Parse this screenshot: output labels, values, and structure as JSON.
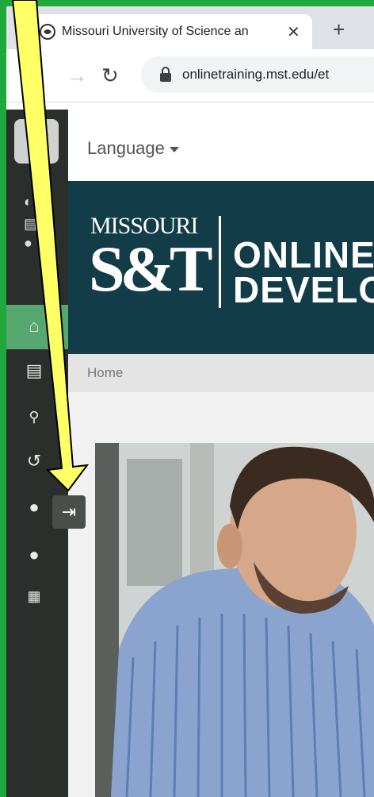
{
  "browser": {
    "tab_title": "Missouri University of Science an",
    "new_tab_label": "+",
    "url": "onlinetraining.mst.edu/et"
  },
  "page": {
    "language_label": "Language",
    "logo_top": "MISSOURI",
    "logo_mark": "S&T",
    "banner_line1": "ONLINE F",
    "banner_line2": "DEVELOP",
    "breadcrumb_home": "Home"
  },
  "sidebar": {
    "items": [
      {
        "icon": "home-icon"
      },
      {
        "icon": "book-icon"
      },
      {
        "icon": "search-icon"
      },
      {
        "icon": "history-icon"
      },
      {
        "icon": "chat-icon"
      },
      {
        "icon": "user-icon"
      },
      {
        "icon": "calendar-icon"
      }
    ],
    "collapse_icon": "expand-sidebar-icon"
  },
  "colors": {
    "banner_bg": "#123c48",
    "sidebar_bg": "#2b2f2c",
    "active_item": "#57a771",
    "annotation_arrow": "#ffff66",
    "frame_border": "#1fa83c"
  }
}
